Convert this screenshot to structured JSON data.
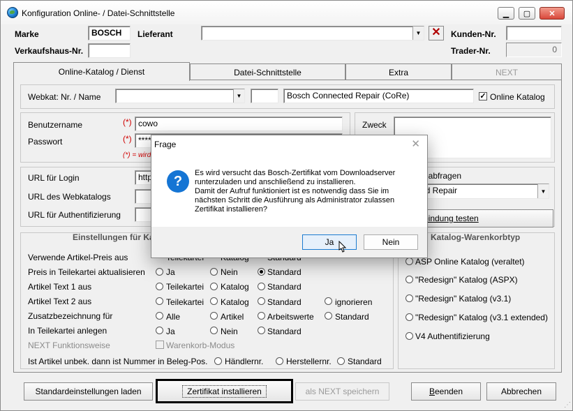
{
  "window": {
    "title": "Konfiguration Online- / Datei-Schnittstelle"
  },
  "header": {
    "marke_label": "Marke",
    "marke_value": "BOSCH",
    "lieferant_label": "Lieferant",
    "lieferant_value": "",
    "kunden_nr_label": "Kunden-Nr.",
    "kunden_nr_value": "",
    "verkaufshaus_label": "Verkaufshaus-Nr.",
    "verkaufshaus_value": "",
    "trader_label": "Trader-Nr.",
    "trader_value": "0"
  },
  "tabs": [
    {
      "label": "Online-Katalog / Dienst"
    },
    {
      "label": "Datei-Schnittstelle"
    },
    {
      "label": "Extra"
    },
    {
      "label": "NEXT"
    }
  ],
  "webkat": {
    "label": "Webkat: Nr. / Name",
    "nr_value": "",
    "code_value": "",
    "name_value": "Bosch Connected Repair (CoRe)",
    "online_katalog_label": "Online Katalog",
    "online_katalog_checked": true
  },
  "login": {
    "benutzername_label": "Benutzername",
    "benutzername_value": "cowo",
    "passwort_label": "Passwort",
    "passwort_value": "****",
    "required_mark": "(*)",
    "required_note": "(*) = wird",
    "zweck_label": "Zweck"
  },
  "urls": {
    "login_label": "URL für Login",
    "login_value": "http",
    "webkatalog_label": "URL des Webkatalogs",
    "auth_label": "URL für Authentifizierung"
  },
  "right_panel": {
    "abfragen_label": "eabfragen",
    "select_value": "ed Repair",
    "verbindung_button": "rbindung testen"
  },
  "settings": {
    "title": "Einstellungen für Ka",
    "rows": [
      {
        "label": "Verwende Artikel-Preis aus",
        "options": [
          "Teilekartei",
          "Katalog",
          "Standard"
        ]
      },
      {
        "label": "Preis in Teilekartei aktualisieren",
        "options": [
          "Ja",
          "Nein",
          "Standard"
        ]
      },
      {
        "label": "Artikel Text 1 aus",
        "options": [
          "Teilekartei",
          "Katalog",
          "Standard"
        ]
      },
      {
        "label": "Artikel Text 2 aus",
        "options": [
          "Teilekartei",
          "Katalog",
          "Standard",
          "ignorieren"
        ]
      },
      {
        "label": "Zusatzbezeichnung für",
        "options": [
          "Alle",
          "Artikel",
          "Arbeitswerte",
          "Standard"
        ]
      },
      {
        "label": "In Teilekartei anlegen",
        "options": [
          "Ja",
          "Nein",
          "Standard"
        ]
      }
    ],
    "next_label": "NEXT Funktionsweise",
    "warenkorb_label": "Warenkorb-Modus",
    "unbek_label": "Ist Artikel unbek. dann ist Nummer in Beleg-Pos.",
    "unbek_options": [
      "Händlernr.",
      "Herstellernr.",
      "Standard"
    ]
  },
  "warenkorb": {
    "title": "Katalog-Warenkorbtyp",
    "options": [
      "ASP Online Katalog (veraltet)",
      "\"Redesign\" Katalog (ASPX)",
      "\"Redesign\" Katalog (v3.1)",
      "\"Redesign\" Katalog (v3.1 extended)",
      "V4 Authentifizierung"
    ]
  },
  "footer": {
    "standard_button": "Standardeinstellungen laden",
    "zertifikat_button": "Zertifikat installieren",
    "next_save_button": "als NEXT speichern",
    "beenden_button": "Beenden",
    "beenden_rest": "eenden",
    "abbrechen_button": "Abbrechen"
  },
  "dialog": {
    "title": "Frage",
    "message_lines": [
      "Es wird versucht das Bosch-Zertifikat vom Downloadserver",
      "runterzuladen und anschließend zu installieren.",
      "Damit der Aufruf funktioniert ist es notwendig dass Sie im",
      "nächsten Schritt die Ausführung als Administrator zulassen",
      "Zertifikat installieren?"
    ],
    "yes_button": "Ja",
    "no_button": "Nein"
  },
  "icons": {
    "app": "globe-icon",
    "question": "question-icon"
  }
}
